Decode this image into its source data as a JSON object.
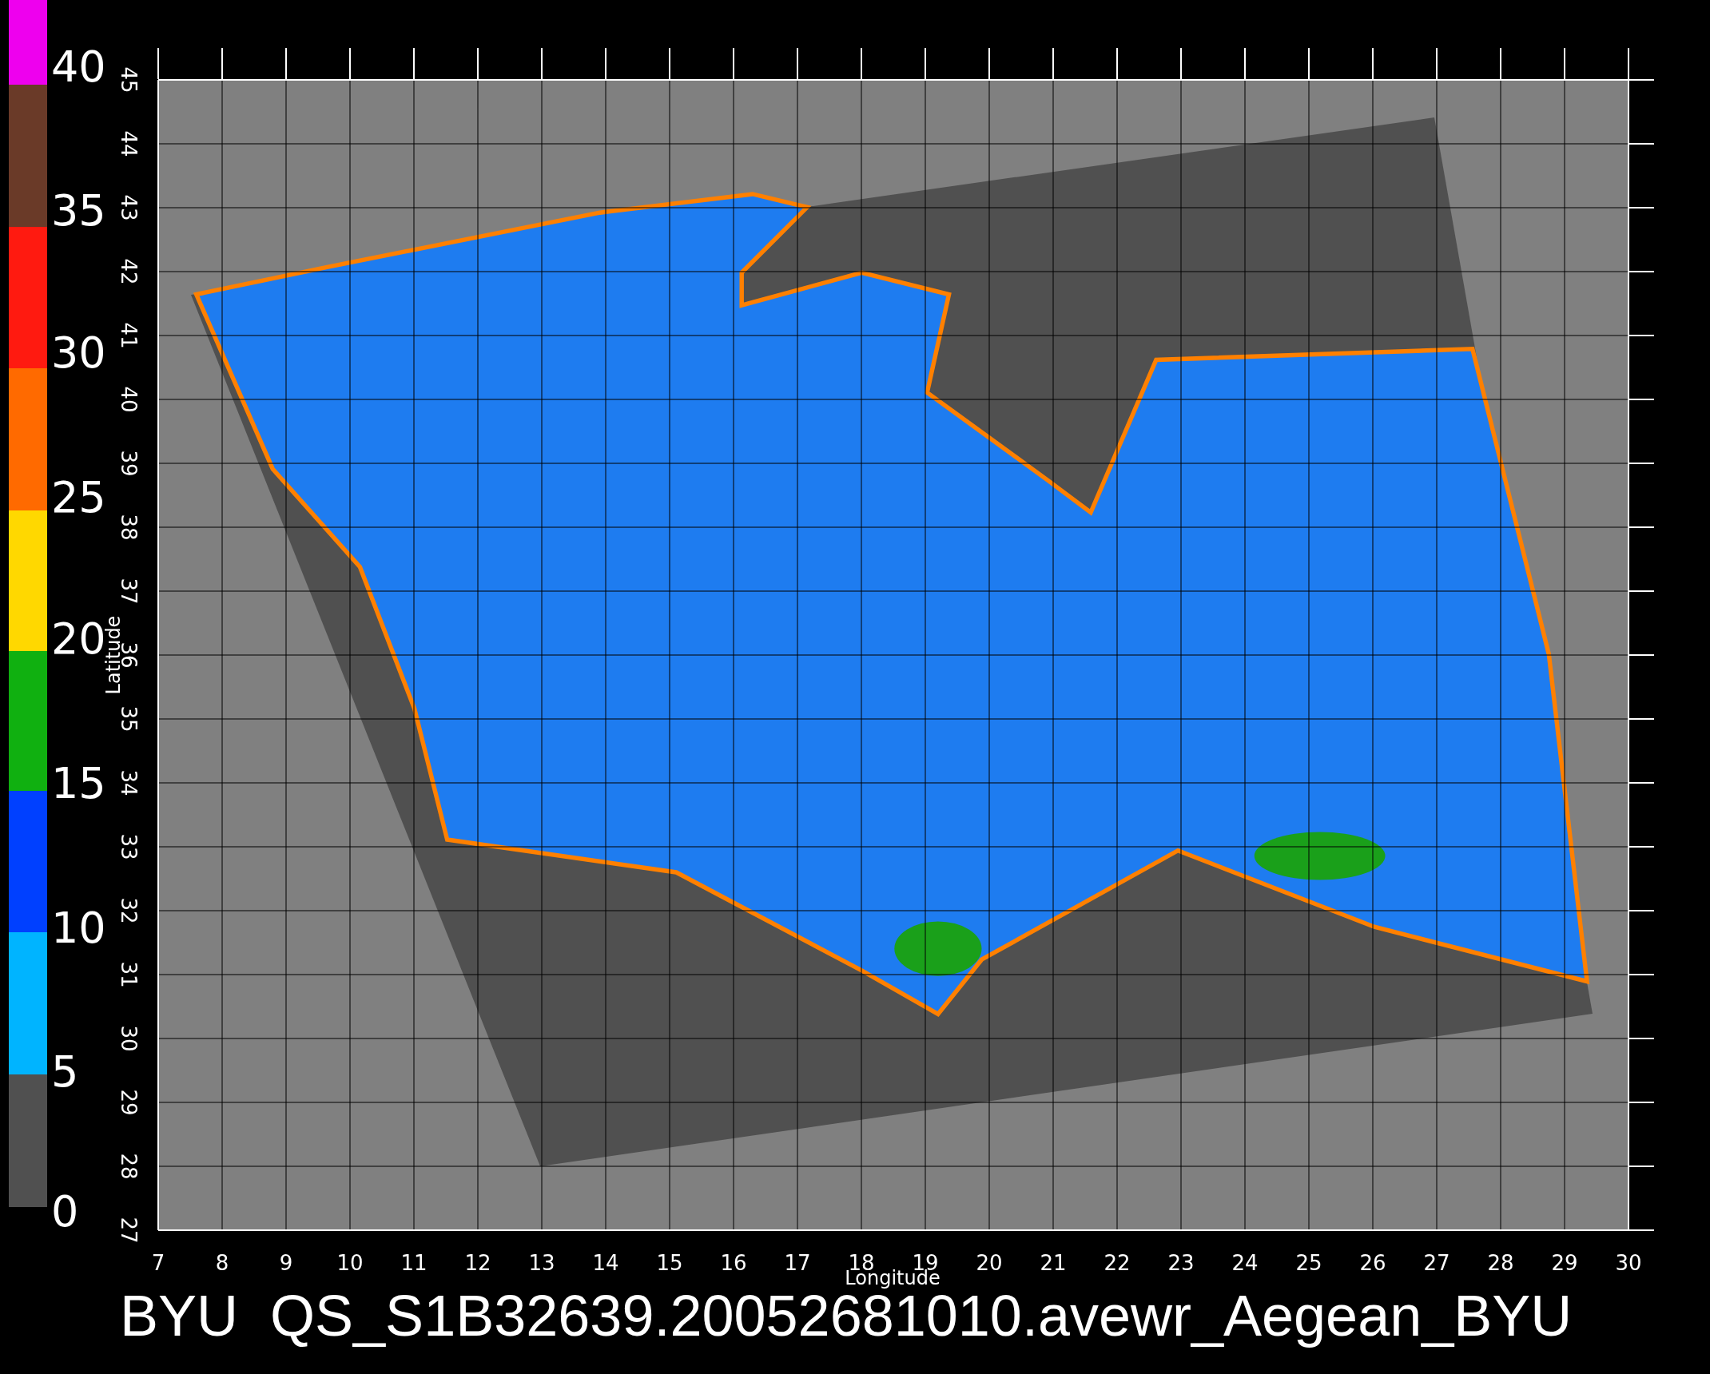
{
  "colorbar": {
    "segments": [
      {
        "color": "#ee00ee"
      },
      {
        "color": "#6a3a28"
      },
      {
        "color": "#ff1a10"
      },
      {
        "color": "#ff6a00"
      },
      {
        "color": "#ffd800"
      },
      {
        "color": "#10b010"
      },
      {
        "color": "#0040ff"
      },
      {
        "color": "#00b4ff"
      },
      {
        "color": "#505050"
      }
    ],
    "labels": [
      "40",
      "35",
      "30",
      "25",
      "20",
      "15",
      "10",
      "5",
      "0"
    ]
  },
  "plot": {
    "x_axis": {
      "title": "Longitude",
      "ticks": [
        "7",
        "8",
        "9",
        "10",
        "11",
        "12",
        "13",
        "14",
        "15",
        "16",
        "17",
        "18",
        "19",
        "20",
        "21",
        "22",
        "23",
        "24",
        "25",
        "26",
        "27",
        "28",
        "29",
        "30"
      ]
    },
    "y_axis": {
      "title": "Latitude",
      "ticks": [
        "27",
        "28",
        "29",
        "30",
        "31",
        "32",
        "33",
        "34",
        "35",
        "36",
        "37",
        "38",
        "39",
        "40",
        "41",
        "42",
        "43",
        "44",
        "45"
      ]
    }
  },
  "title": "BYU  QS_S1B32639.20052681010.avewr_Aegean_BYU"
}
